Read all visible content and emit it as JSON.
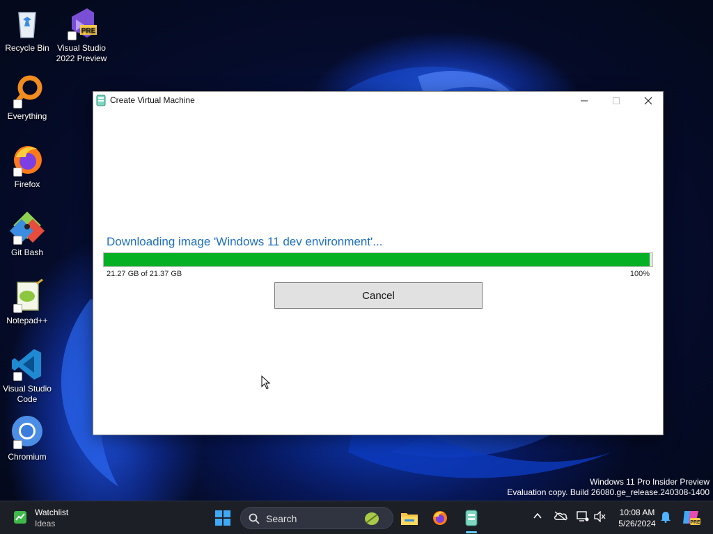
{
  "desktop": {
    "icons": [
      {
        "label": "Recycle Bin"
      },
      {
        "label": "Visual Studio 2022 Preview",
        "badge": "PRE"
      },
      {
        "label": "Everything"
      },
      {
        "label": "Firefox"
      },
      {
        "label": "Git Bash"
      },
      {
        "label": "Notepad++"
      },
      {
        "label": "Visual Studio Code"
      },
      {
        "label": "Chromium"
      }
    ],
    "watermark": {
      "line1": "Windows 11 Pro Insider Preview",
      "line2": "Evaluation copy. Build 26080.ge_release.240308-1400"
    }
  },
  "window": {
    "title": "Create Virtual Machine",
    "status_text": "Downloading image 'Windows 11 dev environment'...",
    "progress": {
      "fraction": 0.995,
      "size_text": "21.27 GB of 21.37 GB",
      "percent_text": "100%",
      "fill_color": "#06b025"
    },
    "cancel_label": "Cancel"
  },
  "taskbar": {
    "widget": {
      "title": "Watchlist",
      "subtitle": "Ideas"
    },
    "search_label": "Search",
    "apps": [
      "windows-start-icon",
      "search-icon",
      "file-explorer-icon",
      "firefox-icon",
      "dev-home-icon"
    ],
    "tray_icons": [
      "chevron-up-icon",
      "onedrive-icon",
      "network-icon",
      "volume-muted-icon",
      "notification-bell-icon",
      "copilot-icon"
    ],
    "clock": {
      "time": "10:08 AM",
      "date": "5/26/2024"
    },
    "copilot_badge": "PRE"
  }
}
